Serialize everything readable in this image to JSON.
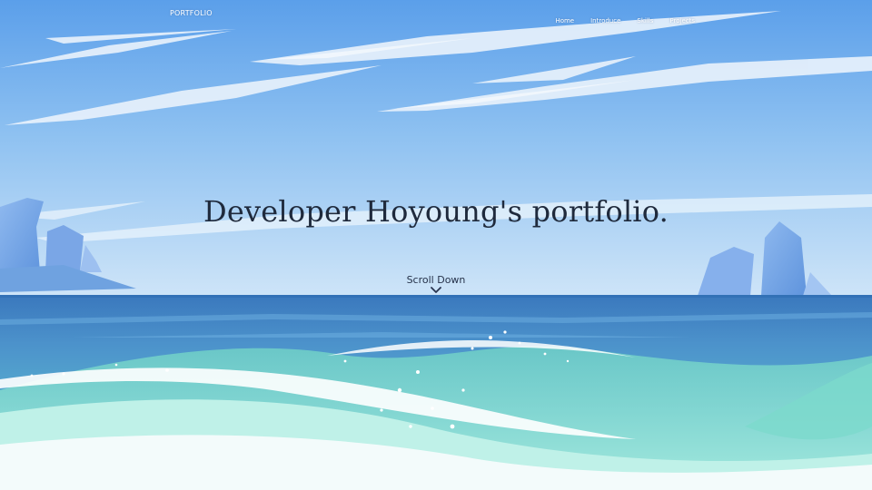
{
  "nav": {
    "logo": "PORTFOLIO",
    "links": [
      "Home",
      "Introduce",
      "Skills",
      "Projects"
    ]
  },
  "hero": {
    "title": "Developer Hoyoung's portfolio.",
    "scroll_label": "Scroll Down"
  },
  "icons": {
    "scroll": "chevron-down-icon"
  },
  "colors": {
    "sky_top": "#63a4ec",
    "sky_horizon": "#c9e2f8",
    "sea_deep": "#3f7fc2",
    "sea_mid": "#4f9bd0",
    "sea_teal": "#5fc3c4",
    "foam": "#ffffff",
    "title_text": "#1f2a3c",
    "nav_text": "#ffffff"
  }
}
